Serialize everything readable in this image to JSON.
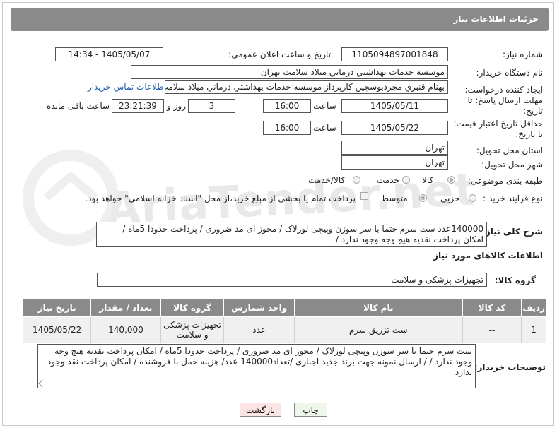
{
  "header": {
    "title": "جزئیات اطلاعات نیاز"
  },
  "watermark": {
    "text": "AriaTender.net"
  },
  "form": {
    "need_number": {
      "label": "شماره نیاز:",
      "value": "1105094897001848"
    },
    "announce_datetime": {
      "label": "تاریخ و ساعت اعلان عمومی:",
      "value": "1405/05/07 - 14:34"
    },
    "buyer_org": {
      "label": "نام دستگاه خریدار:",
      "value": "موسسه خدمات بهداشتي درماني ميلاد سلامت تهران"
    },
    "requester": {
      "label": "ایجاد کننده درخواست:",
      "value": "بهنام قنبري مجردبوسچين كارپرداز موسسه خدمات بهداشتي درماني ميلاد سلامت تهران",
      "contact_link": "اطلاعات تماس خریدار"
    },
    "reply_deadline": {
      "label": "مهلت ارسال پاسخ: تا تاریخ:",
      "date": "1405/05/11",
      "time_label": "ساعت",
      "time": "16:00",
      "days": "3",
      "days_label": "روز و",
      "remaining": "23:21:39",
      "remaining_label": "ساعت باقی مانده"
    },
    "price_validity": {
      "label": "حداقل تاریخ اعتبار قیمت: تا تاریخ:",
      "date": "1405/05/22",
      "time_label": "ساعت",
      "time": "16:00"
    },
    "delivery_province": {
      "label": "استان محل تحویل:",
      "value": "تهران"
    },
    "delivery_city": {
      "label": "شهر محل تحویل:",
      "value": "تهران"
    },
    "category": {
      "label": "طبقه بندی موضوعی:",
      "options": [
        "کالا",
        "خدمت",
        "کالا/خدمت"
      ],
      "selected": "کالا"
    },
    "process_type": {
      "label": "نوع فرآیند خرید :",
      "options": [
        "جزیی",
        "متوسط"
      ],
      "selected": "متوسط",
      "payment_text": "پرداخت تمام یا بخشی از مبلغ خرید،از محل \"اسناد خزانه اسلامی\" خواهد بود."
    }
  },
  "summary": {
    "label": "شرح کلی نیاز:",
    "text": "140000عدد ست سرم حتما با سر سوزن  وپیچی لورلاک / مجوز ای مد ضروری / پرداخت حدودا  5ماه / امکان پرداخت نقدیه هیچ وجه وجود ندارد /"
  },
  "items_section": {
    "title": "اطلاعات کالاهای مورد نیاز",
    "group_label": "گروه کالا:",
    "group_value": "تجهیزات پزشکی و سلامت",
    "columns": [
      "ردیف",
      "کد کالا",
      "نام کالا",
      "واحد شمارش",
      "گروه کالا",
      "تعداد / مقدار",
      "تاریخ نیاز"
    ],
    "rows": [
      [
        "1",
        "--",
        "ست تزریق سرم",
        "عدد",
        "تجهیزات پزشکی و سلامت",
        "140,000",
        "1405/05/22"
      ]
    ]
  },
  "buyer_notes": {
    "label": "توضیحات خریدار:",
    "text": "ست سرم حتما با سر سوزن  وپیچی لورلاک / مجوز ای مد ضروری / پرداخت حدودا  5ماه / امکان پرداخت نقدیه هیچ وجه وجود ندارد /  / ارسال نمونه جهت  برند  جدید اجباری /تعداد140000 عدد/ هزینه حمل با فروشنده  /  امکان پرداخت نقد وجود ندارد"
  },
  "buttons": {
    "print": "چاپ",
    "back": "بازگشت"
  },
  "colors": {
    "header": "#8a8a8a",
    "link": "#1f5fb0",
    "back_button": "#fde4e4",
    "print_button": "#eef7ea"
  }
}
